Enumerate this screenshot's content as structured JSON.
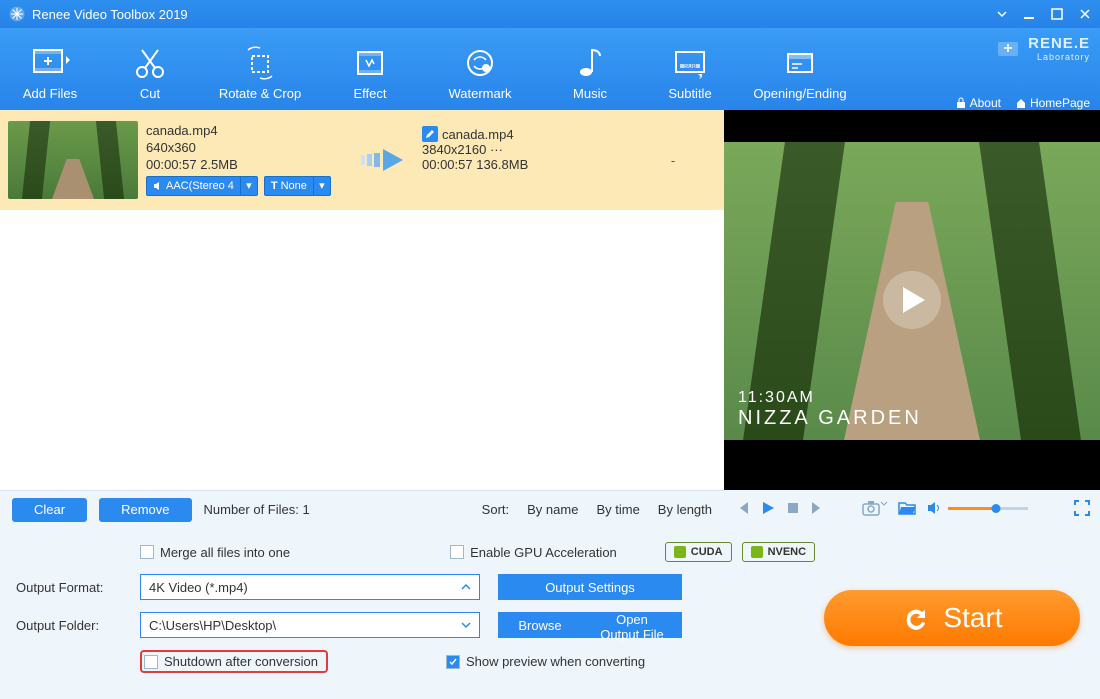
{
  "title": "Renee Video Toolbox 2019",
  "brand": {
    "name": "RENE.E",
    "sub": "Laboratory",
    "about": "About",
    "homepage": "HomePage"
  },
  "toolbar": {
    "add": "Add Files",
    "cut": "Cut",
    "rotate": "Rotate & Crop",
    "effect": "Effect",
    "watermark": "Watermark",
    "music": "Music",
    "subtitle": "Subtitle",
    "opening": "Opening/Ending"
  },
  "file": {
    "src_name": "canada.mp4",
    "src_res": "640x360",
    "src_info": "00:00:57  2.5MB",
    "dst_name": "canada.mp4",
    "dst_res": "3840x2160   ···",
    "dst_info": "00:00:57  136.8MB",
    "audio_pill": "AAC(Stereo 4",
    "text_pill": "None",
    "dash": "-"
  },
  "overlay": {
    "time": "11:30AM",
    "place": "NIZZA GARDEN"
  },
  "listtools": {
    "clear": "Clear",
    "remove": "Remove",
    "count_label": "Number of Files:  ",
    "count": "1",
    "sort": "Sort:",
    "byname": "By name",
    "bytime": "By time",
    "bylength": "By length"
  },
  "bottom": {
    "merge": "Merge all files into one",
    "gpu": "Enable GPU Acceleration",
    "cuda": "CUDA",
    "nvenc": "NVENC",
    "format_label": "Output Format:",
    "format_value": "4K Video (*.mp4)",
    "out_settings": "Output Settings",
    "folder_label": "Output Folder:",
    "folder_value": "C:\\Users\\HP\\Desktop\\",
    "browse": "Browse",
    "openout": "Open Output File",
    "shutdown": "Shutdown after conversion",
    "preview": "Show preview when converting",
    "start": "Start"
  }
}
